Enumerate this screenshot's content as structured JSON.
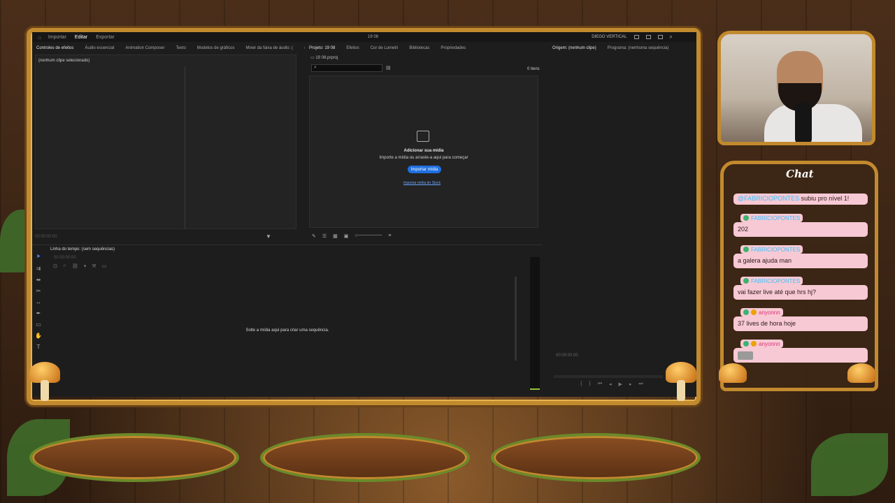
{
  "app": {
    "menu": [
      "Importar",
      "Editar",
      "Exportar"
    ],
    "active_menu": "Editar",
    "project_title": "19 08",
    "workspace": "DIEGO VERTICAL"
  },
  "left_panel": {
    "tabs": [
      "Controles de efeitos",
      "Áudio essencial",
      "Animation Composer",
      "Texto",
      "Modelos de gráficos",
      "Mixer da faixa de áudio: ("
    ],
    "empty_msg": "(nenhum clipe selecionado)",
    "timecode": "00:00:00:00"
  },
  "project_panel": {
    "tabs": [
      "Projeto: 19 08",
      "Efeitos",
      "Cor de Lumetri",
      "Bibliotecas",
      "Propriedades"
    ],
    "file": "19 08.prproj",
    "items_count": "0 itens",
    "empty_title": "Adicionar sua mídia",
    "empty_sub": "Importe a mídia ou arraste-a aqui para começar",
    "import_btn": "Importar mídia",
    "stock_link": "Importar mídia do Stock"
  },
  "monitor": {
    "tabs": [
      "Origem: (nenhum clipe)",
      "Programa: (nenhuma sequência)"
    ],
    "timecode": "00:00:00:00"
  },
  "timeline": {
    "title": "Linha do tempo: (sem sequências)",
    "timecode": "00:00:00:00",
    "drop_msg": "Solte a mídia aqui para criar uma sequência."
  },
  "chat": {
    "title": "Chat",
    "first_line_user": "@FABRICIOPONTES",
    "first_line_text": "subiu pro nível 1!",
    "messages": [
      {
        "user": "FABRICIOPONTES",
        "text": "202"
      },
      {
        "user": "FABRICIOPONTES",
        "text": "a galera ajuda man"
      },
      {
        "user": "FABRICIOPONTES",
        "text": "vai fazer live até que hrs hj?"
      },
      {
        "user": "anyonnn",
        "text": "37 lives de hora hoje"
      },
      {
        "user": "anyonnn",
        "text": ""
      }
    ]
  },
  "colors": {
    "accent": "#1f6fe0",
    "frame": "#c28a2e",
    "chat_bubble": "#f7c9d4"
  }
}
